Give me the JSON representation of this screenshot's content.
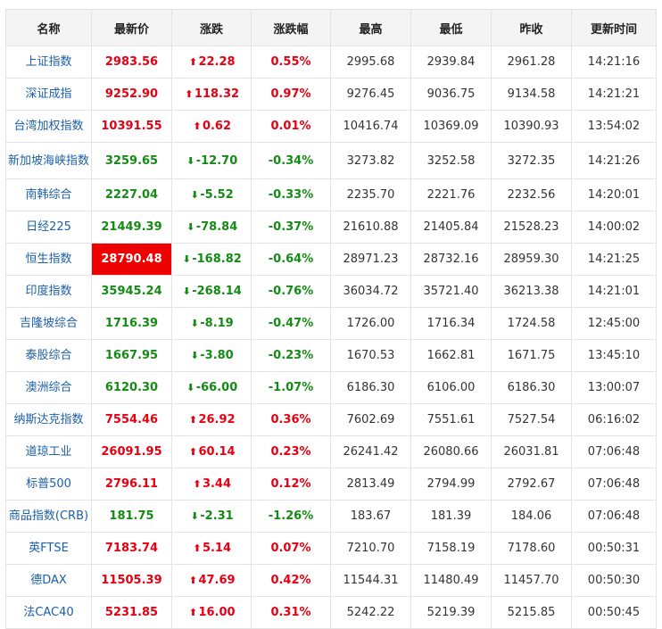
{
  "colors": {
    "up": "#e60012",
    "down": "#148b14",
    "highlight": "#ee0000",
    "name_link": "#1c5fa8"
  },
  "header": {
    "name": "名称",
    "latest": "最新价",
    "change": "涨跌",
    "change_pct": "涨跌幅",
    "high": "最高",
    "low": "最低",
    "prev_close": "昨收",
    "update_time": "更新时间"
  },
  "rows": [
    {
      "name": "上证指数",
      "latest": "2983.56",
      "change": "22.28",
      "pct": "0.55%",
      "high": "2995.68",
      "low": "2939.84",
      "prev": "2961.28",
      "time": "14:21:16",
      "dir": "up"
    },
    {
      "name": "深证成指",
      "latest": "9252.90",
      "change": "118.32",
      "pct": "0.97%",
      "high": "9276.45",
      "low": "9036.75",
      "prev": "9134.58",
      "time": "14:21:21",
      "dir": "up"
    },
    {
      "name": "台湾加权指数",
      "latest": "10391.55",
      "change": "0.62",
      "pct": "0.01%",
      "high": "10416.74",
      "low": "10369.09",
      "prev": "10390.93",
      "time": "13:54:02",
      "dir": "up"
    },
    {
      "name": "新加坡海峡指数",
      "latest": "3259.65",
      "change": "-12.70",
      "pct": "-0.34%",
      "high": "3273.82",
      "low": "3252.58",
      "prev": "3272.35",
      "time": "14:21:26",
      "dir": "down",
      "tall": true
    },
    {
      "name": "南韩综合",
      "latest": "2227.04",
      "change": "-5.52",
      "pct": "-0.33%",
      "high": "2235.70",
      "low": "2221.76",
      "prev": "2232.56",
      "time": "14:20:01",
      "dir": "down"
    },
    {
      "name": "日经225",
      "latest": "21449.39",
      "change": "-78.84",
      "pct": "-0.37%",
      "high": "21610.88",
      "low": "21405.84",
      "prev": "21528.23",
      "time": "14:00:02",
      "dir": "down"
    },
    {
      "name": "恒生指数",
      "latest": "28790.48",
      "change": "-168.82",
      "pct": "-0.64%",
      "high": "28971.23",
      "low": "28732.16",
      "prev": "28959.30",
      "time": "14:21:25",
      "dir": "down",
      "highlight": true
    },
    {
      "name": "印度指数",
      "latest": "35945.24",
      "change": "-268.14",
      "pct": "-0.76%",
      "high": "36034.72",
      "low": "35721.40",
      "prev": "36213.38",
      "time": "14:21:01",
      "dir": "down"
    },
    {
      "name": "吉隆坡综合",
      "latest": "1716.39",
      "change": "-8.19",
      "pct": "-0.47%",
      "high": "1726.00",
      "low": "1716.34",
      "prev": "1724.58",
      "time": "12:45:00",
      "dir": "down"
    },
    {
      "name": "泰股综合",
      "latest": "1667.95",
      "change": "-3.80",
      "pct": "-0.23%",
      "high": "1670.53",
      "low": "1662.81",
      "prev": "1671.75",
      "time": "13:45:10",
      "dir": "down"
    },
    {
      "name": "澳洲综合",
      "latest": "6120.30",
      "change": "-66.00",
      "pct": "-1.07%",
      "high": "6186.30",
      "low": "6106.00",
      "prev": "6186.30",
      "time": "13:00:07",
      "dir": "down"
    },
    {
      "name": "纳斯达克指数",
      "latest": "7554.46",
      "change": "26.92",
      "pct": "0.36%",
      "high": "7602.69",
      "low": "7551.61",
      "prev": "7527.54",
      "time": "06:16:02",
      "dir": "up"
    },
    {
      "name": "道琼工业",
      "latest": "26091.95",
      "change": "60.14",
      "pct": "0.23%",
      "high": "26241.42",
      "low": "26080.66",
      "prev": "26031.81",
      "time": "07:06:48",
      "dir": "up"
    },
    {
      "name": "标普500",
      "latest": "2796.11",
      "change": "3.44",
      "pct": "0.12%",
      "high": "2813.49",
      "low": "2794.99",
      "prev": "2792.67",
      "time": "07:06:48",
      "dir": "up"
    },
    {
      "name": "商品指数(CRB)",
      "latest": "181.75",
      "change": "-2.31",
      "pct": "-1.26%",
      "high": "183.67",
      "low": "181.39",
      "prev": "184.06",
      "time": "07:06:48",
      "dir": "down"
    },
    {
      "name": "英FTSE",
      "latest": "7183.74",
      "change": "5.14",
      "pct": "0.07%",
      "high": "7210.70",
      "low": "7158.19",
      "prev": "7178.60",
      "time": "00:50:31",
      "dir": "up"
    },
    {
      "name": "德DAX",
      "latest": "11505.39",
      "change": "47.69",
      "pct": "0.42%",
      "high": "11544.31",
      "low": "11480.49",
      "prev": "11457.70",
      "time": "00:50:30",
      "dir": "up"
    },
    {
      "name": "法CAC40",
      "latest": "5231.85",
      "change": "16.00",
      "pct": "0.31%",
      "high": "5242.22",
      "low": "5219.39",
      "prev": "5215.85",
      "time": "00:50:45",
      "dir": "up"
    }
  ]
}
